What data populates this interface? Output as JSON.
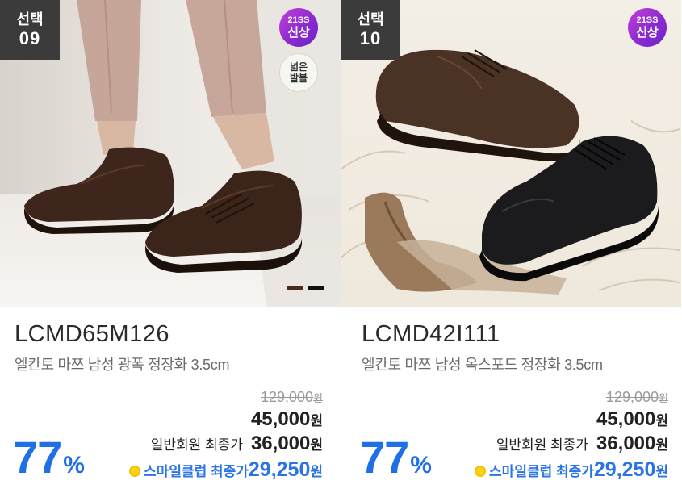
{
  "products": [
    {
      "pick_label": "선택",
      "pick_number": "09",
      "new_badge": {
        "line1": "21SS",
        "line2": "신상"
      },
      "wide_badge": {
        "line1": "넓은",
        "line2": "발볼"
      },
      "swatch_colors": [
        "#4a2c1e",
        "#111111"
      ],
      "model": "LCMD65M126",
      "description": "엘칸토 마쯔 남성 광폭 정장화 3.5cm",
      "original_price": "129,000",
      "sale_price": "45,000",
      "member_label": "일반회원 최종가",
      "member_price": "36,000",
      "smile_label": "스마일클럽 최종가",
      "smile_price": "29,250",
      "currency": "원",
      "discount": "77",
      "discount_unit": "%"
    },
    {
      "pick_label": "선택",
      "pick_number": "10",
      "new_badge": {
        "line1": "21SS",
        "line2": "신상"
      },
      "model": "LCMD42I111",
      "description": "엘칸토 마쯔 남성 옥스포드 정장화 3.5cm",
      "original_price": "129,000",
      "sale_price": "45,000",
      "member_label": "일반회원 최종가",
      "member_price": "36,000",
      "smile_label": "스마일클럽 최종가",
      "smile_price": "29,250",
      "currency": "원",
      "discount": "77",
      "discount_unit": "%"
    }
  ],
  "colors": {
    "accent_blue": "#1f6fe5",
    "badge_purple": "#8b2bd0",
    "pick_badge_bg": "#3b3b3b"
  }
}
